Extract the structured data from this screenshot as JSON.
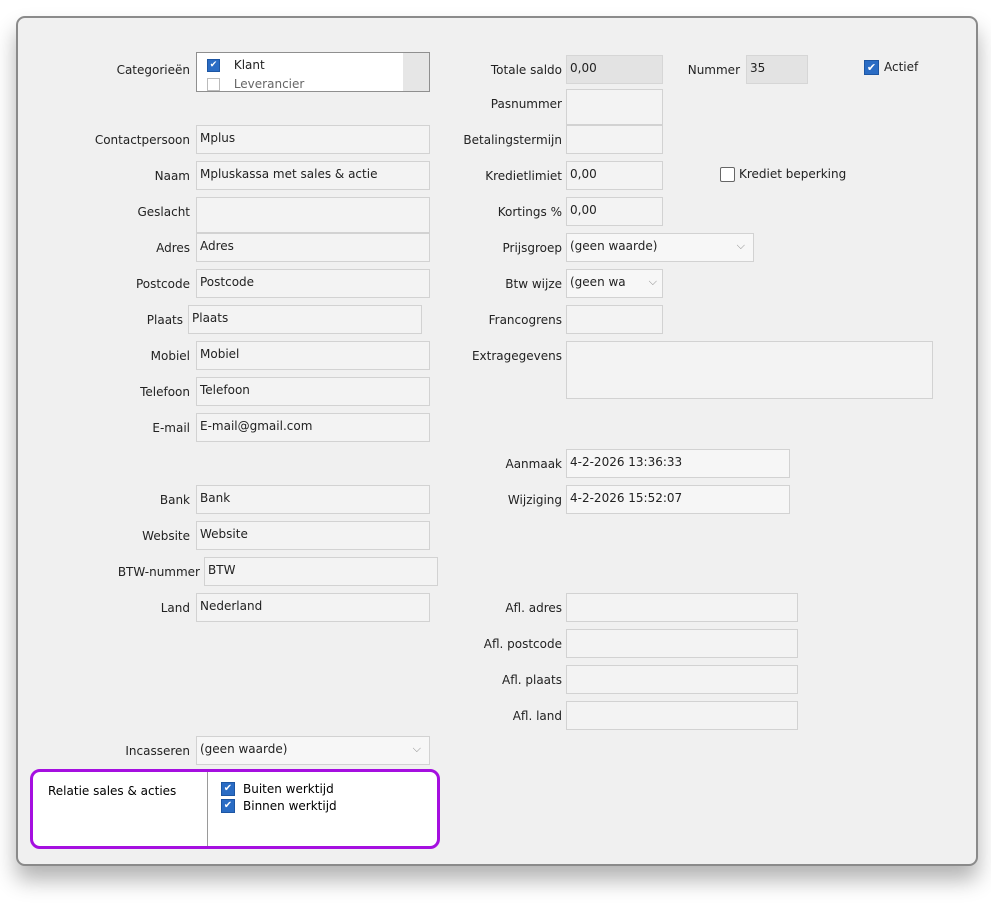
{
  "categories": {
    "label": "Categorieën",
    "items": [
      {
        "label": "Klant",
        "checked": true
      },
      {
        "label": "Leverancier",
        "checked": false
      }
    ]
  },
  "left": {
    "contactpersoon": {
      "label": "Contactpersoon",
      "value": "Mplus"
    },
    "naam": {
      "label": "Naam",
      "value": "Mpluskassa met sales & actie"
    },
    "geslacht": {
      "label": "Geslacht",
      "value": ""
    },
    "adres": {
      "label": "Adres",
      "value": "Adres"
    },
    "postcode": {
      "label": "Postcode",
      "value": "Postcode"
    },
    "plaats": {
      "label": "Plaats",
      "value": "Plaats"
    },
    "mobiel": {
      "label": "Mobiel",
      "value": "Mobiel"
    },
    "telefoon": {
      "label": "Telefoon",
      "value": "Telefoon"
    },
    "email": {
      "label": "E-mail",
      "value": "E-mail@gmail.com"
    },
    "bank": {
      "label": "Bank",
      "value": "Bank"
    },
    "website": {
      "label": "Website",
      "value": "Website"
    },
    "btw_nummer": {
      "label": "BTW-nummer",
      "value": "BTW"
    },
    "land": {
      "label": "Land",
      "value": "Nederland"
    },
    "incasseren": {
      "label": "Incasseren",
      "value": "(geen waarde)"
    }
  },
  "middle": {
    "totale_saldo": {
      "label": "Totale saldo",
      "value": "0,00"
    },
    "pasnummer": {
      "label": "Pasnummer",
      "value": ""
    },
    "betalingstermijn": {
      "label": "Betalingstermijn",
      "value": ""
    },
    "kredietlimiet": {
      "label": "Kredietlimiet",
      "value": "0,00"
    },
    "kortings": {
      "label": "Kortings %",
      "value": "0,00"
    },
    "prijsgroep": {
      "label": "Prijsgroep",
      "value": "(geen waarde)"
    },
    "btw_wijze": {
      "label": "Btw wijze",
      "value": "(geen wa"
    },
    "francogrens": {
      "label": "Francogrens",
      "value": ""
    },
    "extragegevens": {
      "label": "Extragegevens",
      "value": ""
    },
    "aanmaak": {
      "label": "Aanmaak",
      "value": "4-2-2026 13:36:33"
    },
    "wijziging": {
      "label": "Wijziging",
      "value": "4-2-2026 15:52:07"
    },
    "afl_adres": {
      "label": "Afl. adres",
      "value": ""
    },
    "afl_postcode": {
      "label": "Afl. postcode",
      "value": ""
    },
    "afl_plaats": {
      "label": "Afl. plaats",
      "value": ""
    },
    "afl_land": {
      "label": "Afl. land",
      "value": ""
    }
  },
  "right": {
    "nummer": {
      "label": "Nummer",
      "value": "35"
    },
    "actief": {
      "label": "Actief",
      "checked": true
    },
    "krediet_beperking": {
      "label": "Krediet beperking",
      "checked": false
    }
  },
  "relatie_sales": {
    "label": "Relatie sales & acties",
    "options": [
      {
        "label": "Buiten werktijd",
        "checked": true
      },
      {
        "label": "Binnen werktijd",
        "checked": true
      }
    ]
  },
  "icons": {
    "check": "✔",
    "chevron": "⌵"
  },
  "colors": {
    "highlight_border": "#a50fe0",
    "checkbox_checked": "#2a6cc4"
  }
}
